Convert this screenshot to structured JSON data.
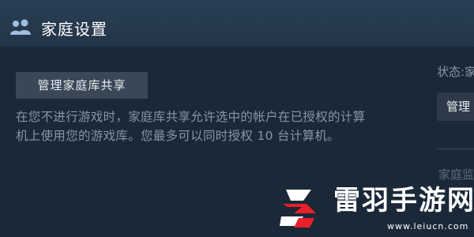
{
  "header": {
    "title": "家庭设置",
    "icon": "family-users-icon"
  },
  "main": {
    "manage_button_label": "管理家庭库共享",
    "description_line1": "在您不进行游戏时，家庭库共享允许选中的帐户在已授权的计算",
    "description_line2": "机上使用您的游戏库。您最多可以同时授权 10 台计算机。"
  },
  "status": {
    "label": "状态:家",
    "button_label": "管理",
    "partial_text": "家庭监"
  },
  "watermark": {
    "brand_text": "雷羽手游网",
    "url": "www.leiucn.com",
    "logo_color": "#e8202a"
  },
  "colors": {
    "background": "#1b2838",
    "header": "#233447",
    "button": "#3a4756"
  }
}
